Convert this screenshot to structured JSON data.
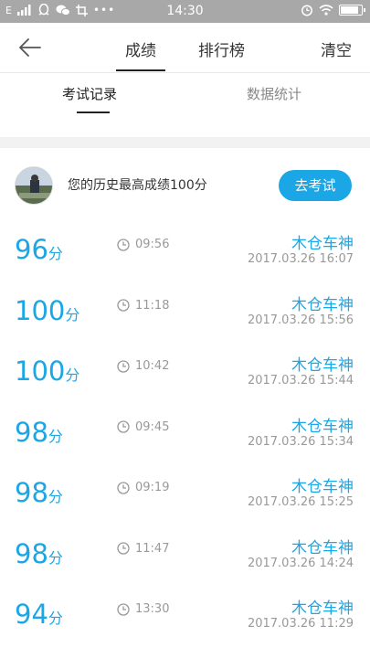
{
  "status_bar": {
    "time": "14:30",
    "left_icons": [
      "E-network-icon",
      "signal-icon",
      "qq-icon",
      "wechat-icon",
      "crop-icon",
      "more-dots-icon"
    ],
    "right_icons": [
      "alarm-icon",
      "wifi-icon",
      "battery-icon"
    ]
  },
  "navbar": {
    "tabs": [
      {
        "label": "成绩",
        "active": true
      },
      {
        "label": "排行榜",
        "active": false
      }
    ],
    "clear_label": "清空"
  },
  "subtabs": [
    {
      "label": "考试记录",
      "active": true
    },
    {
      "label": "数据统计",
      "active": false
    }
  ],
  "best": {
    "text": "您的历史最高成绩100分",
    "button_label": "去考试"
  },
  "accent_color": "#1ba6e6",
  "records": [
    {
      "score": "96",
      "unit": "分",
      "duration": "09:56",
      "name": "木仓车神",
      "date": "2017.03.26  16:07"
    },
    {
      "score": "100",
      "unit": "分",
      "duration": "11:18",
      "name": "木仓车神",
      "date": "2017.03.26  15:56"
    },
    {
      "score": "100",
      "unit": "分",
      "duration": "10:42",
      "name": "木仓车神",
      "date": "2017.03.26  15:44"
    },
    {
      "score": "98",
      "unit": "分",
      "duration": "09:45",
      "name": "木仓车神",
      "date": "2017.03.26  15:34"
    },
    {
      "score": "98",
      "unit": "分",
      "duration": "09:19",
      "name": "木仓车神",
      "date": "2017.03.26  15:25"
    },
    {
      "score": "98",
      "unit": "分",
      "duration": "11:47",
      "name": "木仓车神",
      "date": "2017.03.26  14:24"
    },
    {
      "score": "94",
      "unit": "分",
      "duration": "13:30",
      "name": "木仓车神",
      "date": "2017.03.26  11:29"
    }
  ]
}
